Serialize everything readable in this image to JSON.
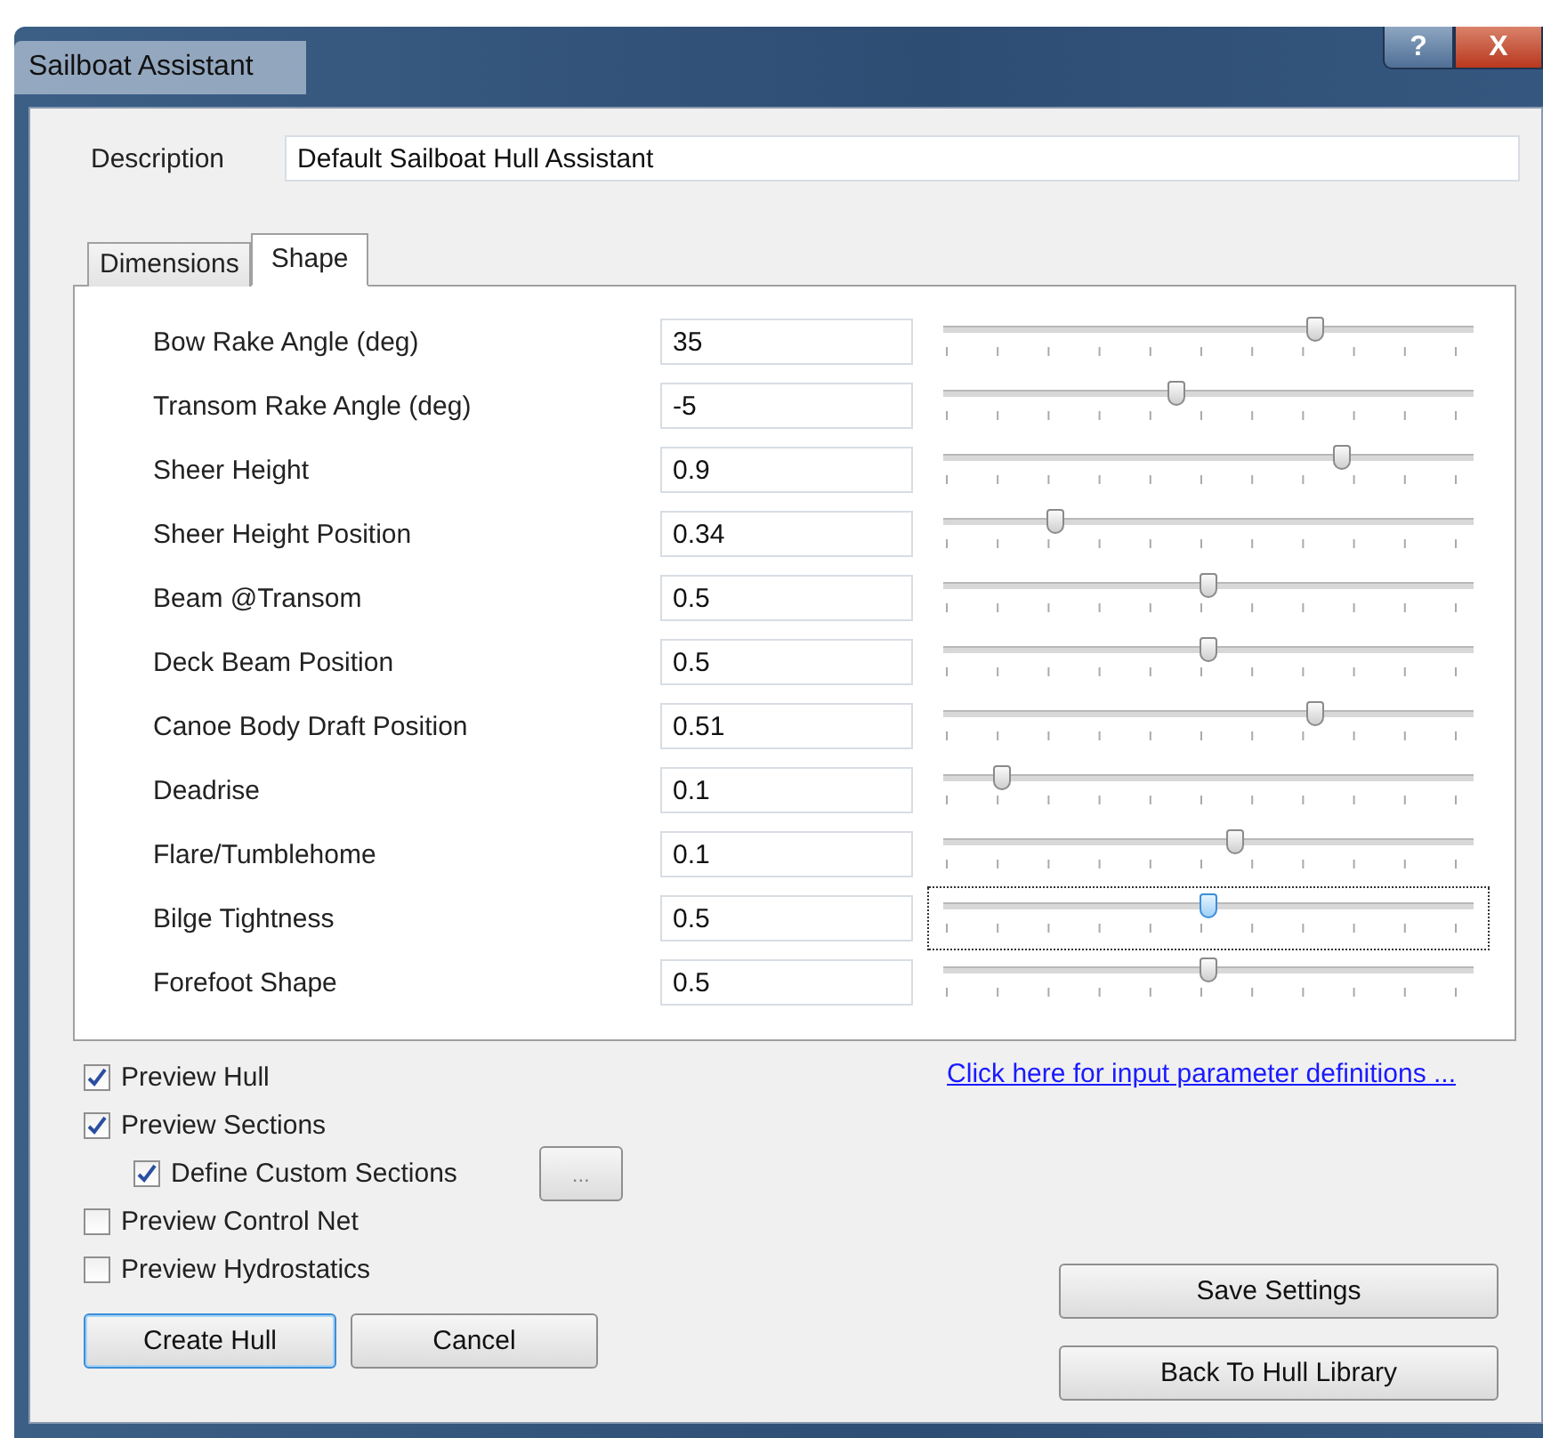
{
  "window": {
    "title": "Sailboat Assistant",
    "help_button": "?",
    "close_button": "X"
  },
  "description": {
    "label": "Description",
    "value": "Default Sailboat Hull Assistant"
  },
  "tabs": [
    {
      "label": "Dimensions",
      "selected": false
    },
    {
      "label": "Shape",
      "selected": true
    }
  ],
  "parameters": [
    {
      "label": "Bow Rake Angle (deg)",
      "value": "35",
      "level": 0.7,
      "focused": false
    },
    {
      "label": "Transom Rake Angle (deg)",
      "value": "-5",
      "level": 0.44,
      "focused": false
    },
    {
      "label": "Sheer Height",
      "value": "0.9",
      "level": 0.75,
      "focused": false
    },
    {
      "label": "Sheer Height Position",
      "value": "0.34",
      "level": 0.21,
      "focused": false
    },
    {
      "label": "Beam @Transom",
      "value": "0.5",
      "level": 0.5,
      "focused": false
    },
    {
      "label": "Deck Beam Position",
      "value": "0.5",
      "level": 0.5,
      "focused": false
    },
    {
      "label": "Canoe Body Draft Position",
      "value": "0.51",
      "level": 0.7,
      "focused": false
    },
    {
      "label": "Deadrise",
      "value": "0.1",
      "level": 0.11,
      "focused": false
    },
    {
      "label": "Flare/Tumblehome",
      "value": "0.1",
      "level": 0.55,
      "focused": false
    },
    {
      "label": "Bilge Tightness",
      "value": "0.5",
      "level": 0.5,
      "focused": true
    },
    {
      "label": "Forefoot Shape",
      "value": "0.5",
      "level": 0.5,
      "focused": false
    }
  ],
  "options": [
    {
      "label": "Preview Hull",
      "checked": true,
      "indented": false
    },
    {
      "label": "Preview Sections",
      "checked": true,
      "indented": false
    },
    {
      "label": "Define Custom Sections",
      "checked": true,
      "indented": true,
      "button": "..."
    },
    {
      "label": "Preview Control Net",
      "checked": false,
      "indented": false
    },
    {
      "label": "Preview Hydrostatics",
      "checked": false,
      "indented": false
    }
  ],
  "link": "Click here for input parameter definitions ...",
  "buttons": {
    "create": "Create Hull",
    "cancel": "Cancel",
    "save": "Save Settings",
    "back": "Back To Hull Library"
  }
}
